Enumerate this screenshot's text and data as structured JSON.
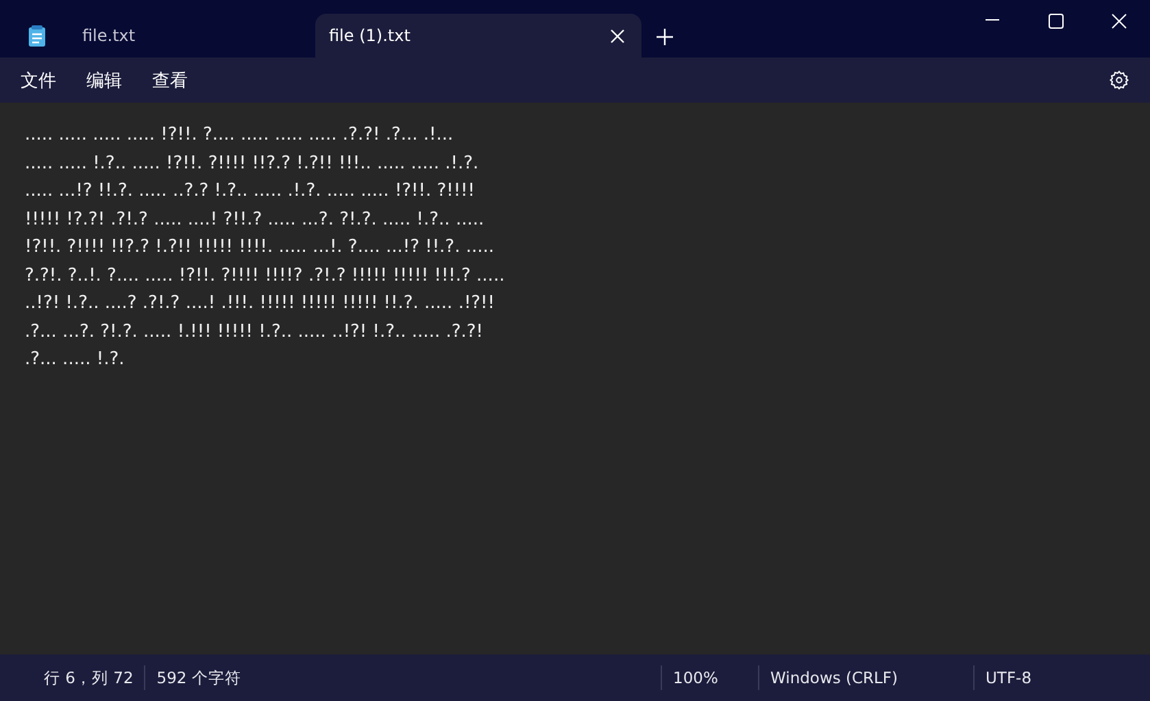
{
  "tabs": [
    {
      "label": "file.txt",
      "selected": false
    },
    {
      "label": "file (1).txt",
      "selected": true
    }
  ],
  "menu": [
    "文件",
    "编辑",
    "查看"
  ],
  "editor": {
    "lines": [
      "..... ..... ..... ..... !?!!. ?.... ..... ..... ..... .?.?! .?... .!...",
      "..... ..... !.?.. ..... !?!!. ?!!!! !!?.? !.?!! !!!.. ..... ..... .!.?.",
      "..... ...!? !!.?. ..... ..?.? !.?.. ..... .!.?. ..... ..... !?!!. ?!!!!",
      "!!!!! !?.?! .?!.? ..... ....! ?!!.? ..... ...?. ?!.?. ..... !.?.. .....",
      "!?!!. ?!!!! !!?.? !.?!! !!!!! !!!!. ..... ...!. ?.... ...!? !!.?. .....",
      "?.?!. ?..!. ?.... ..... !?!!. ?!!!! !!!!? .?!.? !!!!! !!!!! !!!.? .....",
      "..!?! !.?.. ....? .?!.? ....! .!!!. !!!!! !!!!! !!!!! !!.?. ..... .!?!!",
      ".?... ...?. ?!.?. ..... !.!!! !!!!! !.?.. ..... ..!?! !.?.. ..... .?.?!",
      ".?... ..... !.?."
    ]
  },
  "status_bar": {
    "position": "行 6，列 72",
    "count": "592 个字符",
    "zoom": "100%",
    "line_ending": "Windows (CRLF)",
    "encoding": "UTF-8"
  }
}
